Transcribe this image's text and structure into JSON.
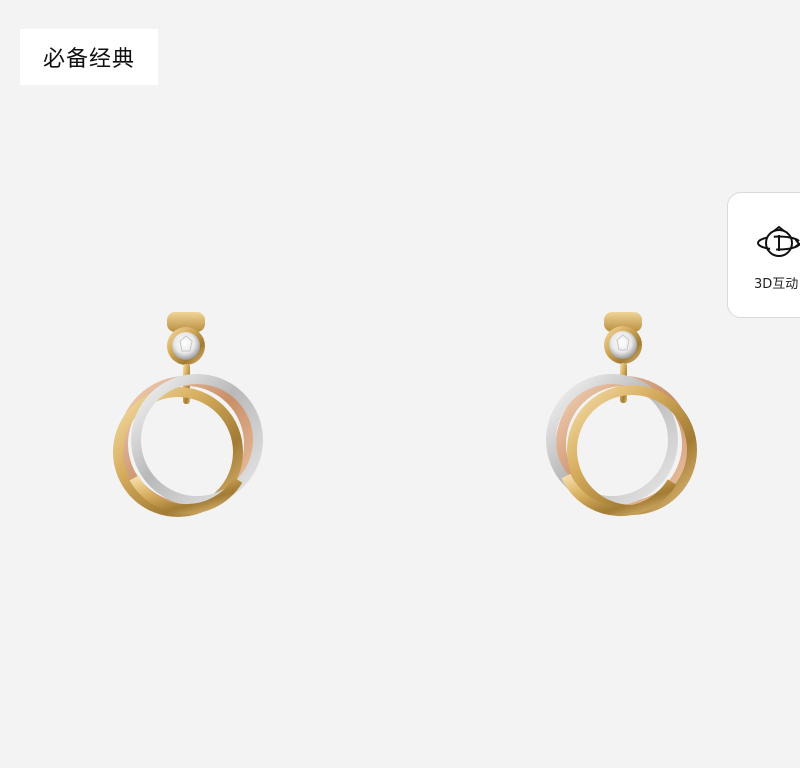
{
  "badge": {
    "label": "必备经典"
  },
  "viewer": {
    "button_label": "3D互动",
    "icon": "3d-rotate-icon"
  },
  "product": {
    "image_subject": "pair-of-trinity-hoop-earrings"
  },
  "colors": {
    "background": "#f3f3f3",
    "yellow_gold": "#d8b161",
    "white_gold": "#c9c9c9",
    "rose_gold": "#e0b28e"
  }
}
